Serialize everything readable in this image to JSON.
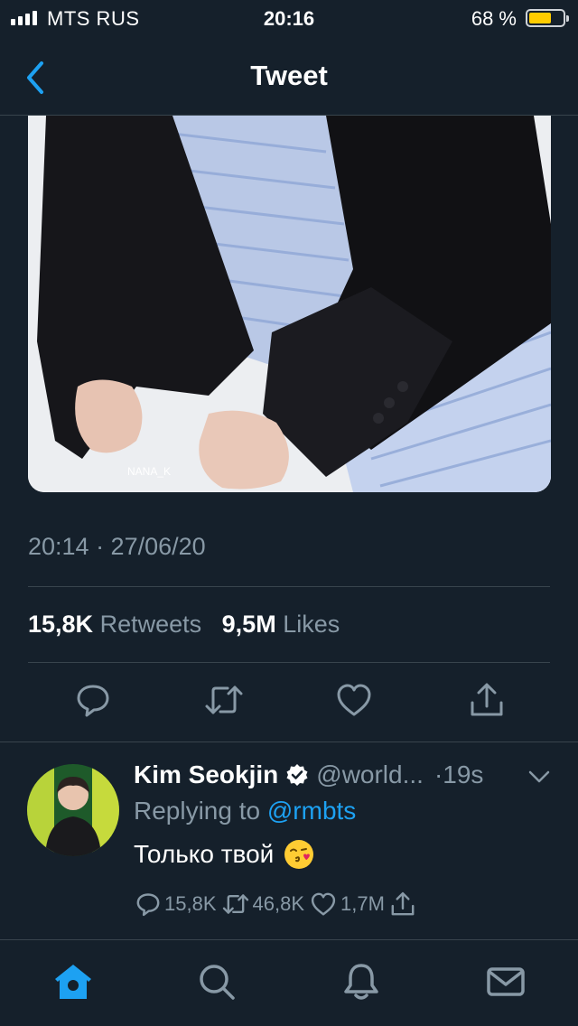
{
  "status_bar": {
    "carrier": "MTS RUS",
    "time": "20:16",
    "battery_percent": "68 %",
    "battery_level": 0.68,
    "battery_color": "#ffcc00"
  },
  "nav": {
    "title": "Tweet",
    "back_icon": "chevron-left-icon"
  },
  "tweet": {
    "image_watermark": "NANA_K",
    "timestamp": "20:14 · 27/06/20",
    "retweets_count": "15,8K",
    "retweets_label": "Retweets",
    "likes_count": "9,5M",
    "likes_label": "Likes",
    "actions": [
      "reply-icon",
      "retweet-icon",
      "like-icon",
      "share-icon"
    ]
  },
  "reply": {
    "name": "Kim Seokjin",
    "handle": "@world...",
    "time": "·19s",
    "replying_prefix": "Replying to",
    "replying_to": "@rmbts",
    "text": "Только твой",
    "emoji": "kissing-face-emoji",
    "reply_count": "15,8K",
    "retweet_count": "46,8K",
    "like_count": "1,7M"
  },
  "tab_bar": {
    "tabs": [
      "home-icon",
      "search-icon",
      "notifications-icon",
      "messages-icon"
    ],
    "active": "home-icon"
  },
  "colors": {
    "background": "#15202b",
    "accent": "#1da1f2",
    "muted": "#8899a6",
    "divider": "#38444d"
  }
}
